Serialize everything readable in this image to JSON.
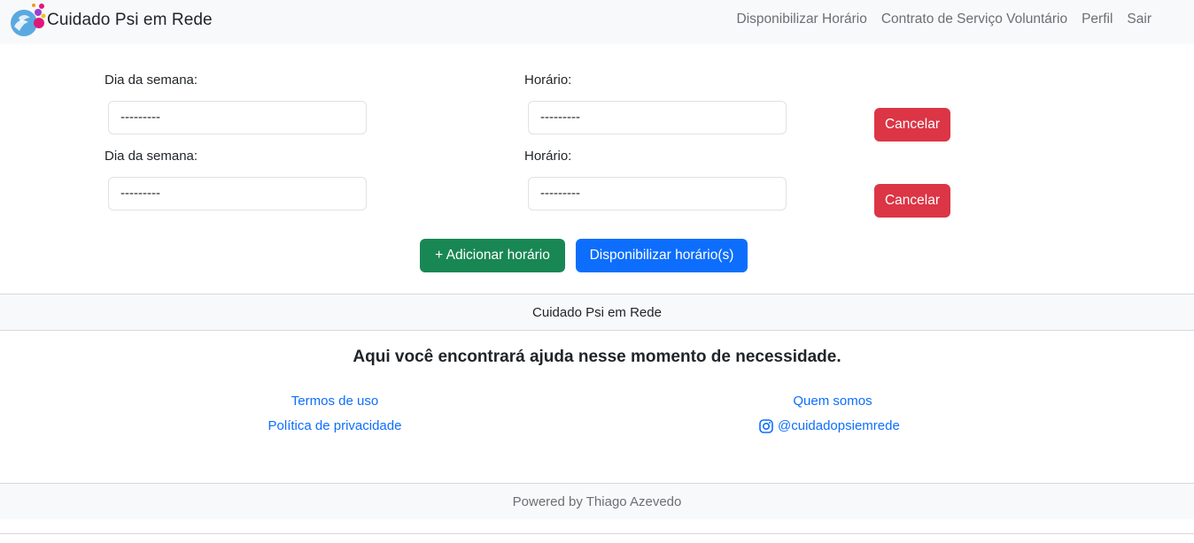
{
  "navbar": {
    "brand_name": "Cuidado Psi em Rede",
    "links": [
      "Disponibilizar Horário",
      "Contrato de Serviço Voluntário",
      "Perfil",
      "Sair"
    ]
  },
  "form": {
    "rows": [
      {
        "day_label": "Dia da semana:",
        "day_value": "---------",
        "time_label": "Horário:",
        "time_value": "---------",
        "cancel_label": "Cancelar"
      },
      {
        "day_label": "Dia da semana:",
        "day_value": "---------",
        "time_label": "Horário:",
        "time_value": "---------",
        "cancel_label": "Cancelar"
      }
    ],
    "add_button_label": "+ Adicionar horário",
    "submit_button_label": "Disponibilizar horário(s)"
  },
  "footer": {
    "site_name": "Cuidado Psi em Rede",
    "tagline": "Aqui você encontrará ajuda nesse momento de necessidade.",
    "links": {
      "terms": "Termos de uso",
      "privacy": "Política de privacidade",
      "about": "Quem somos",
      "instagram": "@cuidadopsiemrede"
    },
    "powered_by": "Powered by Thiago Azevedo"
  },
  "icons": {
    "brand": "brand-logo-icon",
    "instagram": "instagram-icon"
  },
  "colors": {
    "danger": "#dc3545",
    "success": "#198754",
    "primary": "#0d6efd",
    "navbar_bg": "#f8f9fa"
  }
}
